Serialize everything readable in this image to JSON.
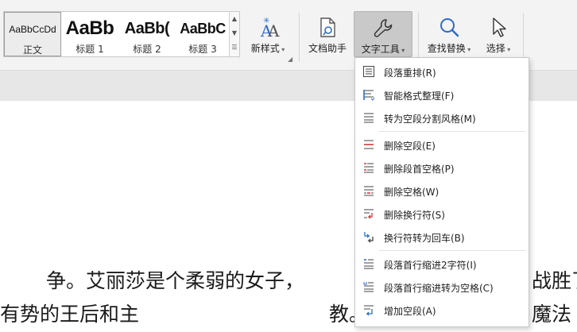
{
  "styles": [
    {
      "sample": "AaBbCcDd",
      "name": "正文",
      "selected": true
    },
    {
      "sample": "AaBb",
      "name": "标题 1"
    },
    {
      "sample": "AaBb(",
      "name": "标题 2"
    },
    {
      "sample": "AaBbC",
      "name": "标题 3"
    }
  ],
  "ribbon": {
    "new_style_label": "新样式",
    "doc_assistant_label": "文档助手",
    "text_tools_label": "文字工具",
    "find_replace_label": "查找替换",
    "select_label": "选择"
  },
  "menu": {
    "items": [
      {
        "label": "段落重排(R)",
        "icon": "paragraph-rearrange-icon"
      },
      {
        "label": "智能格式整理(F)",
        "icon": "smart-format-icon"
      },
      {
        "label": "转为空段分割风格(M)",
        "icon": "empty-paragraph-split-icon"
      },
      {
        "label": "删除空段(E)",
        "icon": "delete-empty-paragraph-icon"
      },
      {
        "label": "删除段首空格(P)",
        "icon": "delete-leading-space-icon"
      },
      {
        "label": "删除空格(W)",
        "icon": "delete-space-icon"
      },
      {
        "label": "删除换行符(S)",
        "icon": "delete-line-break-icon"
      },
      {
        "label": "换行符转为回车(B)",
        "icon": "line-break-to-enter-icon"
      },
      {
        "label": "段落首行缩进2字符(I)",
        "icon": "first-line-indent-icon"
      },
      {
        "label": "段落首行缩进转为空格(C)",
        "icon": "indent-to-space-icon"
      },
      {
        "label": "增加空段(A)",
        "icon": "add-empty-paragraph-icon"
      }
    ]
  },
  "document": {
    "line1_left": "争。艾丽莎是个柔弱的女子，",
    "line1_right": "战胜了",
    "line2_left": "有势的王后和主",
    "line2_right": "教。",
    "line2_far_right": "魔法"
  },
  "colors": {
    "ribbon_bg": "#f3f3f3",
    "active_button_bg": "#c9c9c9",
    "icon_blue": "#2f6cc6",
    "icon_red": "#d23b3b"
  }
}
